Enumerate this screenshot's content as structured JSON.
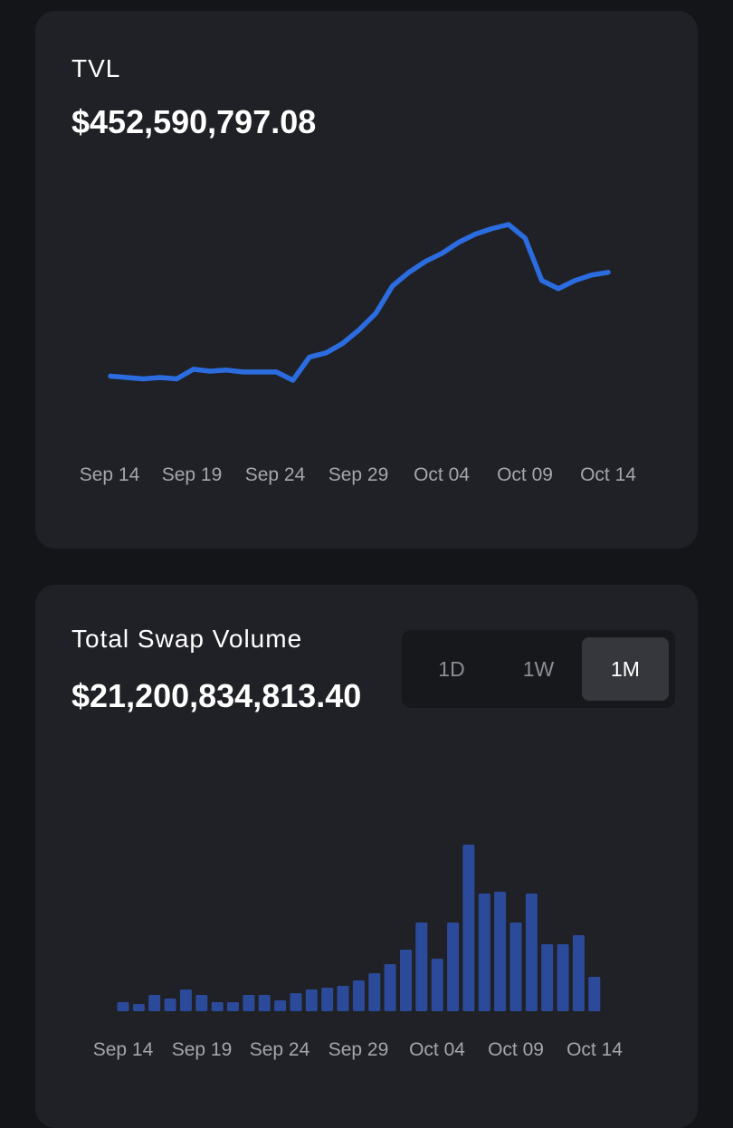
{
  "tvl": {
    "label": "TVL",
    "value": "$452,590,797.08"
  },
  "swap": {
    "label": "Total Swap Volume",
    "value": "$21,200,834,813.40",
    "ranges": [
      "1D",
      "1W",
      "1M"
    ],
    "active_range": "1M"
  },
  "colors": {
    "line": "#2b6de0",
    "bar": "#2b4a9a"
  },
  "chart_data": [
    {
      "type": "line",
      "x_tick_labels": [
        "Sep 14",
        "Sep 19",
        "Sep 24",
        "Sep 29",
        "Oct 04",
        "Oct 09",
        "Oct 14"
      ],
      "x": [
        "Sep 14",
        "Sep 15",
        "Sep 16",
        "Sep 17",
        "Sep 18",
        "Sep 19",
        "Sep 20",
        "Sep 21",
        "Sep 22",
        "Sep 23",
        "Sep 24",
        "Sep 25",
        "Sep 26",
        "Sep 27",
        "Sep 28",
        "Sep 29",
        "Sep 30",
        "Oct 01",
        "Oct 02",
        "Oct 03",
        "Oct 04",
        "Oct 05",
        "Oct 06",
        "Oct 07",
        "Oct 08",
        "Oct 09",
        "Oct 10",
        "Oct 11",
        "Oct 12",
        "Oct 13",
        "Oct 14"
      ],
      "values": [
        0.0,
        -0.5,
        -1.0,
        -0.5,
        -1.0,
        2.5,
        1.8,
        2.2,
        1.5,
        1.5,
        1.5,
        -1.5,
        7.0,
        8.5,
        12.0,
        17.0,
        23.0,
        33.0,
        38.0,
        42.0,
        45.0,
        49.0,
        52.0,
        54.0,
        55.5,
        50.5,
        35.0,
        32.0,
        35.0,
        37.0,
        38.0
      ]
    },
    {
      "type": "bar",
      "x_tick_labels": [
        "Sep 14",
        "Sep 19",
        "Sep 24",
        "Sep 29",
        "Oct 04",
        "Oct 09",
        "Oct 14"
      ],
      "categories": [
        "Sep 14",
        "Sep 15",
        "Sep 16",
        "Sep 17",
        "Sep 18",
        "Sep 19",
        "Sep 20",
        "Sep 21",
        "Sep 22",
        "Sep 23",
        "Sep 24",
        "Sep 25",
        "Sep 26",
        "Sep 27",
        "Sep 28",
        "Sep 29",
        "Sep 30",
        "Oct 01",
        "Oct 02",
        "Oct 03",
        "Oct 04",
        "Oct 05",
        "Oct 06",
        "Oct 07",
        "Oct 08",
        "Oct 09",
        "Oct 10",
        "Oct 11",
        "Oct 12",
        "Oct 13",
        "Oct 14"
      ],
      "values": [
        5,
        4,
        9,
        7,
        12,
        9,
        5,
        5,
        9,
        9,
        6,
        10,
        12,
        13,
        14,
        17,
        21,
        26,
        34,
        49,
        29,
        49,
        92,
        65,
        66,
        49,
        65,
        37,
        37,
        42,
        19
      ]
    }
  ]
}
